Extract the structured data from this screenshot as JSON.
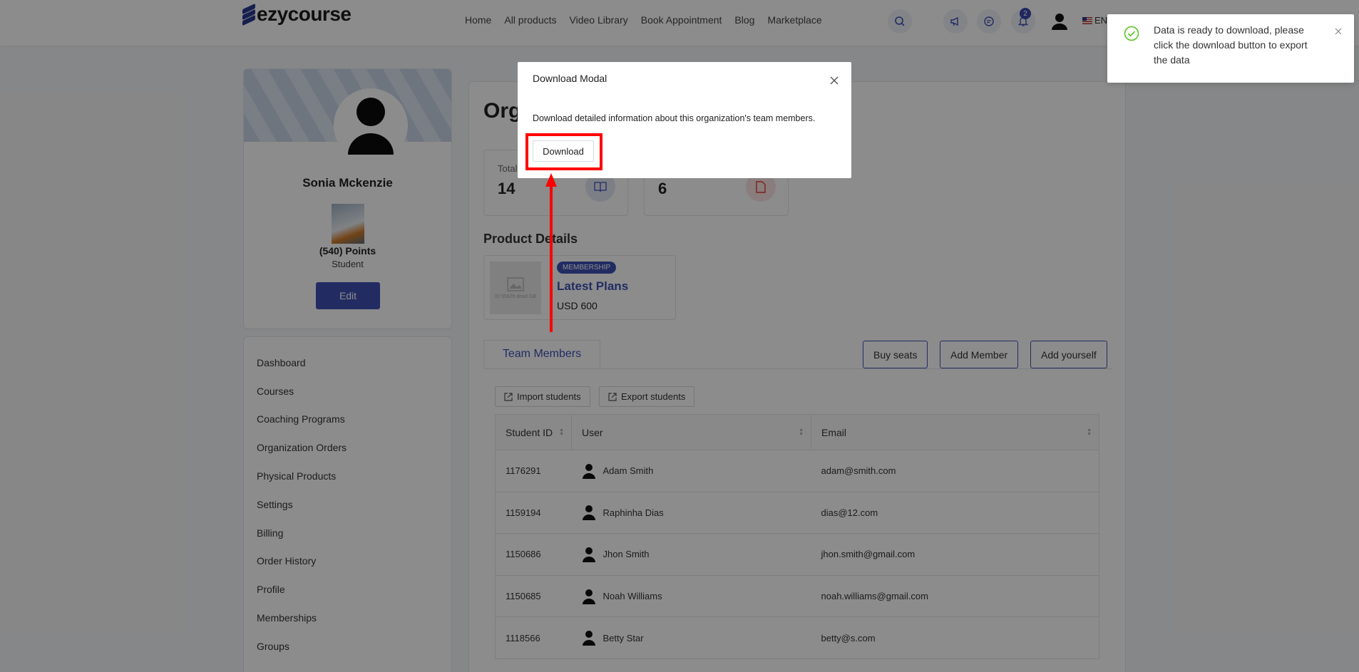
{
  "brand": {
    "name": "ezycourse"
  },
  "nav": [
    "Home",
    "All products",
    "Video Library",
    "Book Appointment",
    "Blog",
    "Marketplace"
  ],
  "header": {
    "notification_count": "2",
    "language": "EN"
  },
  "profile": {
    "name": "Sonia Mckenzie",
    "points": "(540) Points",
    "role": "Student",
    "edit_label": "Edit"
  },
  "menu": [
    "Dashboard",
    "Courses",
    "Coaching Programs",
    "Organization Orders",
    "Physical Products",
    "Settings",
    "Billing",
    "Order History",
    "Profile",
    "Memberships",
    "Groups"
  ],
  "main": {
    "title": "Org",
    "stats": [
      {
        "label": "Total",
        "value": "14",
        "icon": "book-icon",
        "color": "#3f51b5"
      },
      {
        "label": "",
        "value": "6",
        "icon": "document-icon",
        "color": "#e53935"
      }
    ],
    "product_section_title": "Product Details",
    "product": {
      "badge": "MEMBERSHIP",
      "name": "Latest Plans",
      "price": "USD 600",
      "thumb_text": "ID 95629 dead GB"
    },
    "tab_label": "Team Members",
    "buttons": {
      "buy_seats": "Buy seats",
      "add_member": "Add Member",
      "add_yourself": "Add yourself",
      "import": "Import students",
      "export": "Export students"
    },
    "table": {
      "headers": [
        "Student ID",
        "User",
        "Email"
      ],
      "rows": [
        {
          "id": "1176291",
          "name": "Adam Smith",
          "email": "adam@smith.com"
        },
        {
          "id": "1159194",
          "name": "Raphinha Dias",
          "email": "dias@12.com"
        },
        {
          "id": "1150686",
          "name": "Jhon Smith",
          "email": "jhon.smith@gmail.com"
        },
        {
          "id": "1150685",
          "name": "Noah Williams",
          "email": "noah.williams@gmail.com"
        },
        {
          "id": "1118566",
          "name": "Betty Star",
          "email": "betty@s.com"
        }
      ]
    }
  },
  "modal": {
    "title": "Download Modal",
    "text": "Download detailed information about this organization's team members.",
    "download_label": "Download"
  },
  "toast": {
    "message": "Data is ready to download, please click the download button to export the data",
    "color": "#52c41a"
  }
}
